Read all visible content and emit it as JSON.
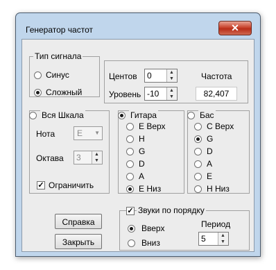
{
  "window": {
    "title": "Генератор частот",
    "close": "✕"
  },
  "signal_type": {
    "title": "Тип сигнала",
    "sine": "Синус",
    "complex": "Сложный",
    "selected": "complex"
  },
  "controls": {
    "cents_label": "Центов",
    "cents_value": "0",
    "level_label": "Уровень",
    "level_value": "-10",
    "frequency_label": "Частота",
    "frequency_value": "82,407"
  },
  "whole_scale": {
    "title": "Вся Шкала",
    "note_label": "Нота",
    "note_value": "E",
    "octave_label": "Октава",
    "octave_value": "3",
    "limit_label": "Ограничить",
    "limit_checked": true
  },
  "guitar": {
    "title": "Гитара",
    "strings": [
      "E Верх",
      "H",
      "G",
      "D",
      "A",
      "E Низ"
    ],
    "selected_index": 5
  },
  "bass": {
    "title": "Бас",
    "strings": [
      "C Верх",
      "G",
      "D",
      "A",
      "E",
      "H Низ"
    ],
    "selected_index": 1
  },
  "sequence": {
    "title": "Звуки по порядку",
    "checked": true,
    "up": "Вверх",
    "down": "Вниз",
    "period_label": "Период",
    "period_value": "5"
  },
  "buttons": {
    "help": "Справка",
    "close": "Закрыть"
  }
}
